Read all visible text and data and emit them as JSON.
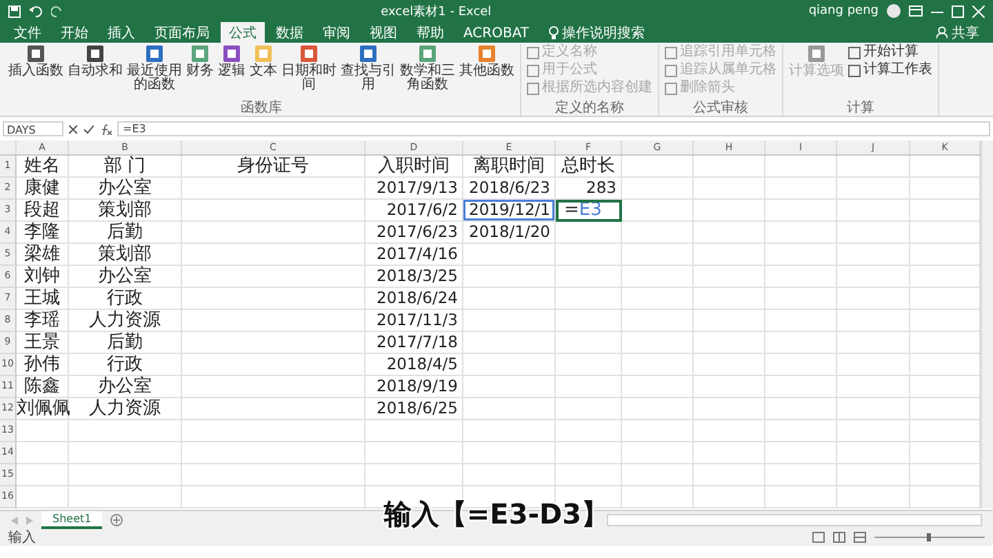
{
  "window": {
    "title": "excel素材1 - Excel",
    "user": "qiang peng"
  },
  "ribbon_tabs": [
    {
      "label": "文件",
      "kind": "tab",
      "selected": false
    },
    {
      "label": "开始",
      "kind": "tab",
      "selected": false
    },
    {
      "label": "插入",
      "kind": "tab",
      "selected": false
    },
    {
      "label": "页面布局",
      "kind": "tab",
      "selected": false
    },
    {
      "label": "公式",
      "kind": "tab",
      "selected": true
    },
    {
      "label": "数据",
      "kind": "tab",
      "selected": false
    },
    {
      "label": "审阅",
      "kind": "tab",
      "selected": false
    },
    {
      "label": "视图",
      "kind": "tab",
      "selected": false
    },
    {
      "label": "帮助",
      "kind": "tab",
      "selected": false
    },
    {
      "label": "ACROBAT",
      "kind": "tab",
      "selected": false
    }
  ],
  "tell_me": "操作说明搜索",
  "share": "共享",
  "ribbon_groups": [
    {
      "label": "函数库",
      "items": [
        {
          "label": "插入函数",
          "kind": "large",
          "disabled": false,
          "color": "#555555"
        },
        {
          "label": "自动求和",
          "kind": "large",
          "disabled": false,
          "color": "#444444"
        },
        {
          "label": "最近使用的函数",
          "kind": "large",
          "disabled": false,
          "color": "#2f6fc0"
        },
        {
          "label": "财务",
          "kind": "large",
          "disabled": false,
          "color": "#5aa57a"
        },
        {
          "label": "逻辑",
          "kind": "large",
          "disabled": false,
          "color": "#8a4fc0"
        },
        {
          "label": "文本",
          "kind": "large",
          "disabled": false,
          "color": "#f0c05a"
        },
        {
          "label": "日期和时间",
          "kind": "large",
          "disabled": false,
          "color": "#d9573b"
        },
        {
          "label": "查找与引用",
          "kind": "large",
          "disabled": false,
          "color": "#2f6fc0"
        },
        {
          "label": "数学和三角函数",
          "kind": "large",
          "disabled": false,
          "color": "#5aa57a"
        },
        {
          "label": "其他函数",
          "kind": "large",
          "disabled": false,
          "color": "#e8822e"
        }
      ]
    },
    {
      "label": "定义的名称",
      "items": [
        {
          "label": "定义名称",
          "kind": "small",
          "disabled": true,
          "color": "#999999"
        },
        {
          "label": "用于公式",
          "kind": "small",
          "disabled": true,
          "color": "#999999"
        },
        {
          "label": "根据所选内容创建",
          "kind": "small",
          "disabled": true,
          "color": "#999999"
        }
      ]
    },
    {
      "label": "公式审核",
      "items": [
        {
          "label": "追踪引用单元格",
          "kind": "small",
          "disabled": true,
          "color": "#999999"
        },
        {
          "label": "追踪从属单元格",
          "kind": "small",
          "disabled": true,
          "color": "#999999"
        },
        {
          "label": "删除箭头",
          "kind": "small",
          "disabled": true,
          "color": "#999999"
        }
      ]
    },
    {
      "label": "计算",
      "items": [
        {
          "label": "计算选项",
          "kind": "large",
          "disabled": true,
          "color": "#999999"
        },
        {
          "label": "开始计算",
          "kind": "small",
          "disabled": false,
          "color": "#666666"
        },
        {
          "label": "计算工作表",
          "kind": "small",
          "disabled": false,
          "color": "#666666"
        }
      ]
    }
  ],
  "formula_bar": {
    "name_box": "DAYS",
    "formula": "=E3"
  },
  "columns": [
    "A",
    "B",
    "C",
    "D",
    "E",
    "F",
    "G",
    "H",
    "I",
    "J",
    "K"
  ],
  "rows": [
    {
      "number": "1",
      "cells": {
        "A": "姓名",
        "B": "部 门",
        "C": "身份证号",
        "D": "入职时间",
        "E": "离职时间",
        "F": "总时长"
      }
    },
    {
      "number": "2",
      "cells": {
        "A": "康健",
        "B": "办公室",
        "D": "2017/9/13",
        "E": "2018/6/23",
        "F": "283"
      }
    },
    {
      "number": "3",
      "cells": {
        "A": "段超",
        "B": "策划部",
        "D": "2017/6/2",
        "E": {
          "text": "2019/12/1",
          "referenced": true,
          "active": false
        },
        "F": {
          "text": "=E3",
          "referenced": false,
          "active": true
        }
      }
    },
    {
      "number": "4",
      "cells": {
        "A": "李隆",
        "B": "后勤",
        "D": "2017/6/23",
        "E": "2018/1/20"
      }
    },
    {
      "number": "5",
      "cells": {
        "A": "梁雄",
        "B": "策划部",
        "D": "2017/4/16"
      }
    },
    {
      "number": "6",
      "cells": {
        "A": "刘钟",
        "B": "办公室",
        "D": "2018/3/25"
      }
    },
    {
      "number": "7",
      "cells": {
        "A": "王城",
        "B": "行政",
        "D": "2018/6/24"
      }
    },
    {
      "number": "8",
      "cells": {
        "A": "李瑶",
        "B": "人力资源",
        "D": "2017/11/3"
      }
    },
    {
      "number": "9",
      "cells": {
        "A": "王景",
        "B": "后勤",
        "D": "2017/7/18"
      }
    },
    {
      "number": "10",
      "cells": {
        "A": "孙伟",
        "B": "行政",
        "D": "2018/4/5"
      }
    },
    {
      "number": "11",
      "cells": {
        "A": "陈鑫",
        "B": "办公室",
        "D": "2018/9/19"
      }
    },
    {
      "number": "12",
      "cells": {
        "A": "刘佩佩",
        "B": "人力资源",
        "D": "2018/6/25"
      }
    },
    {
      "number": "13",
      "cells": {}
    },
    {
      "number": "14",
      "cells": {}
    },
    {
      "number": "15",
      "cells": {}
    },
    {
      "number": "16",
      "cells": {}
    }
  ],
  "caption": "输入【=E3-D3】",
  "sheet_tabs": [
    {
      "label": "Sheet1",
      "selected": true
    }
  ],
  "status_bar": {
    "mode": "输入"
  }
}
